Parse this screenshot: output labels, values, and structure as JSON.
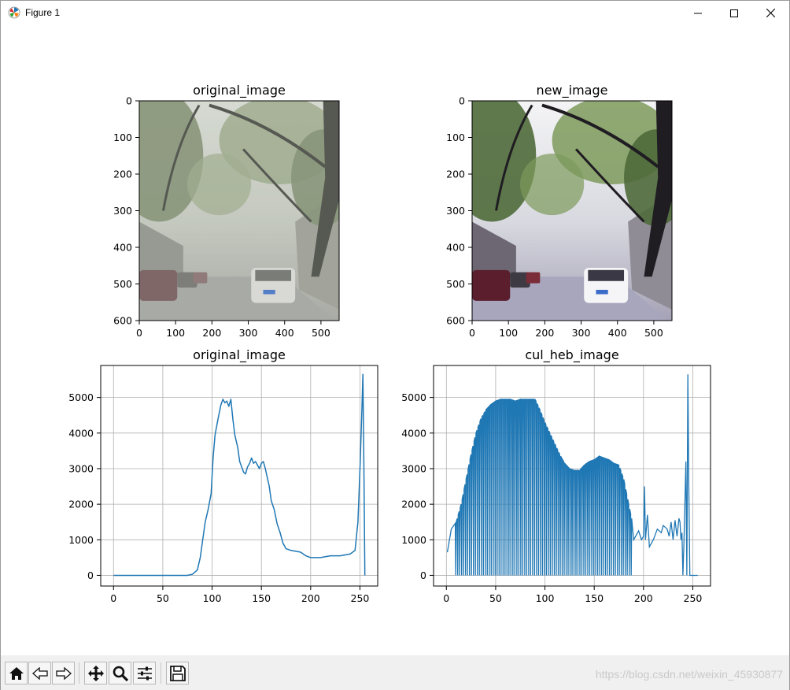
{
  "window": {
    "title": "Figure 1",
    "icons": [
      "matplotlib-logo-icon",
      "minimize-icon",
      "maximize-icon",
      "close-icon"
    ]
  },
  "toolbar": {
    "buttons": [
      {
        "name": "home-button",
        "icon": "home-icon"
      },
      {
        "name": "back-button",
        "icon": "back-arrow-icon"
      },
      {
        "name": "forward-button",
        "icon": "forward-arrow-icon"
      },
      {
        "name": "pan-button",
        "icon": "move-icon"
      },
      {
        "name": "zoom-button",
        "icon": "magnifier-icon"
      },
      {
        "name": "configure-subplots-button",
        "icon": "sliders-icon"
      },
      {
        "name": "save-button",
        "icon": "floppy-disk-icon"
      }
    ],
    "watermark": "https://blog.csdn.net/weixin_45930877"
  },
  "colors": {
    "line": "#1f77b4",
    "grid": "#b0b0b0",
    "toolbar_bg": "#f0f0f0"
  },
  "images": {
    "original": {
      "title": "original_image",
      "xticks": [
        "0",
        "100",
        "200",
        "300",
        "400",
        "500"
      ],
      "yticks": [
        "0",
        "100",
        "200",
        "300",
        "400",
        "500",
        "600"
      ],
      "xlim": [
        0,
        550
      ],
      "ylim": [
        600,
        0
      ],
      "tint": "hazy"
    },
    "new": {
      "title": "new_image",
      "xticks": [
        "0",
        "100",
        "200",
        "300",
        "400",
        "500"
      ],
      "yticks": [
        "0",
        "100",
        "200",
        "300",
        "400",
        "500",
        "600"
      ],
      "xlim": [
        0,
        550
      ],
      "ylim": [
        600,
        0
      ],
      "tint": "contrast-enhanced"
    }
  },
  "chart_data": [
    {
      "type": "line",
      "title": "original_image",
      "xlabel": "",
      "ylabel": "",
      "xlim": [
        -13,
        268
      ],
      "ylim": [
        -300,
        5900
      ],
      "xticks": [
        0,
        50,
        100,
        150,
        200,
        250
      ],
      "yticks": [
        0,
        1000,
        2000,
        3000,
        4000,
        5000
      ],
      "grid": true,
      "series": [
        {
          "x": [
            0,
            60,
            75,
            80,
            85,
            88,
            90,
            93,
            96,
            99,
            101,
            103,
            106,
            109,
            111,
            113,
            115,
            117,
            119,
            121,
            123,
            126,
            128,
            130,
            132,
            134,
            136,
            138,
            140,
            142,
            144,
            146,
            148,
            150,
            152,
            154,
            156,
            158,
            160,
            163,
            166,
            169,
            172,
            175,
            180,
            190,
            195,
            200,
            210,
            220,
            230,
            240,
            245,
            248,
            250,
            252,
            253,
            254,
            255
          ],
          "y": [
            0,
            0,
            0,
            30,
            150,
            500,
            900,
            1500,
            1850,
            2300,
            3300,
            3950,
            4400,
            4800,
            4950,
            4850,
            4900,
            4750,
            4950,
            4400,
            3950,
            3600,
            3200,
            3050,
            2900,
            2850,
            3050,
            3150,
            3300,
            3150,
            3200,
            3100,
            3000,
            3150,
            3200,
            3000,
            2750,
            2500,
            2100,
            1850,
            1450,
            1200,
            900,
            750,
            700,
            650,
            550,
            500,
            500,
            550,
            550,
            600,
            700,
            1500,
            3000,
            4700,
            5650,
            3000,
            0
          ]
        }
      ]
    },
    {
      "type": "line",
      "title": "cul_heb_image",
      "xlabel": "",
      "ylabel": "",
      "xlim": [
        -13,
        268
      ],
      "ylim": [
        -300,
        5900
      ],
      "xticks": [
        0,
        50,
        100,
        150,
        200,
        250
      ],
      "yticks": [
        0,
        1000,
        2000,
        3000,
        4000,
        5000
      ],
      "grid": true,
      "envelope": {
        "x": [
          1,
          5,
          10,
          15,
          20,
          25,
          30,
          35,
          40,
          45,
          50,
          55,
          60,
          65,
          70,
          75,
          80,
          85,
          90,
          95,
          100,
          105,
          110,
          115,
          120,
          125,
          130,
          135,
          140,
          145,
          150,
          155,
          160,
          165,
          170,
          175,
          180,
          185,
          188
        ],
        "y": [
          650,
          1300,
          1500,
          2000,
          2700,
          3400,
          4000,
          4400,
          4650,
          4800,
          4900,
          4950,
          4950,
          4950,
          4900,
          4950,
          4950,
          4950,
          4950,
          4650,
          4300,
          4000,
          3700,
          3400,
          3150,
          3000,
          2950,
          2950,
          3100,
          3200,
          3250,
          3350,
          3300,
          3250,
          3150,
          3100,
          2700,
          2000,
          1600
        ]
      },
      "tail": {
        "x": [
          188,
          190,
          195,
          198,
          200,
          201,
          202,
          204,
          206,
          210,
          214,
          218,
          220,
          224,
          226,
          228,
          230,
          232,
          234,
          236,
          237,
          238,
          239,
          240,
          241,
          242,
          243,
          244,
          245,
          246,
          247,
          248,
          249,
          250,
          251,
          252,
          255
        ],
        "y": [
          1600,
          1000,
          1250,
          1000,
          1100,
          2500,
          1000,
          1700,
          800,
          1000,
          1300,
          1200,
          1400,
          1300,
          1100,
          1500,
          1000,
          1550,
          1100,
          1600,
          1500,
          1000,
          1200,
          0,
          900,
          2000,
          3200,
          0,
          5650,
          2500,
          0,
          0,
          0,
          0,
          0,
          0,
          0
        ]
      }
    }
  ]
}
